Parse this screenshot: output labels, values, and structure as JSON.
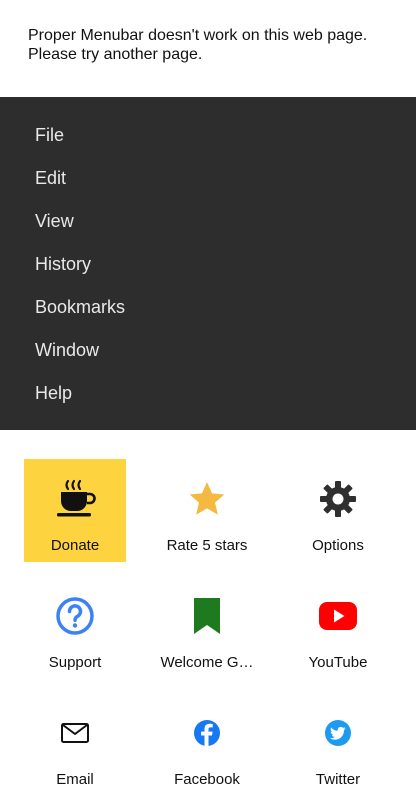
{
  "notice": {
    "text": "Proper Menubar doesn't work on this web page. Please try another page."
  },
  "menu": {
    "items": [
      "File",
      "Edit",
      "View",
      "History",
      "Bookmarks",
      "Window",
      "Help"
    ]
  },
  "tiles": [
    {
      "label": "Donate",
      "icon": "coffee-cup-icon"
    },
    {
      "label": "Rate 5 stars",
      "icon": "star-icon"
    },
    {
      "label": "Options",
      "icon": "gear-icon"
    },
    {
      "label": "Support",
      "icon": "help-circle-icon"
    },
    {
      "label": "Welcome G…",
      "icon": "bookmark-icon"
    },
    {
      "label": "YouTube",
      "icon": "youtube-icon"
    },
    {
      "label": "Email",
      "icon": "mail-icon"
    },
    {
      "label": "Facebook",
      "icon": "facebook-icon"
    },
    {
      "label": "Twitter",
      "icon": "twitter-icon"
    }
  ],
  "colors": {
    "menu_bg": "#2d2d2d",
    "donate_highlight": "#fdd33f",
    "star": "#f5b841",
    "support_blue": "#3b82f6",
    "bookmark_green": "#1f7a1f",
    "youtube_red": "#ff0000",
    "facebook_blue": "#1877f2",
    "twitter_blue": "#1d9bf0"
  }
}
